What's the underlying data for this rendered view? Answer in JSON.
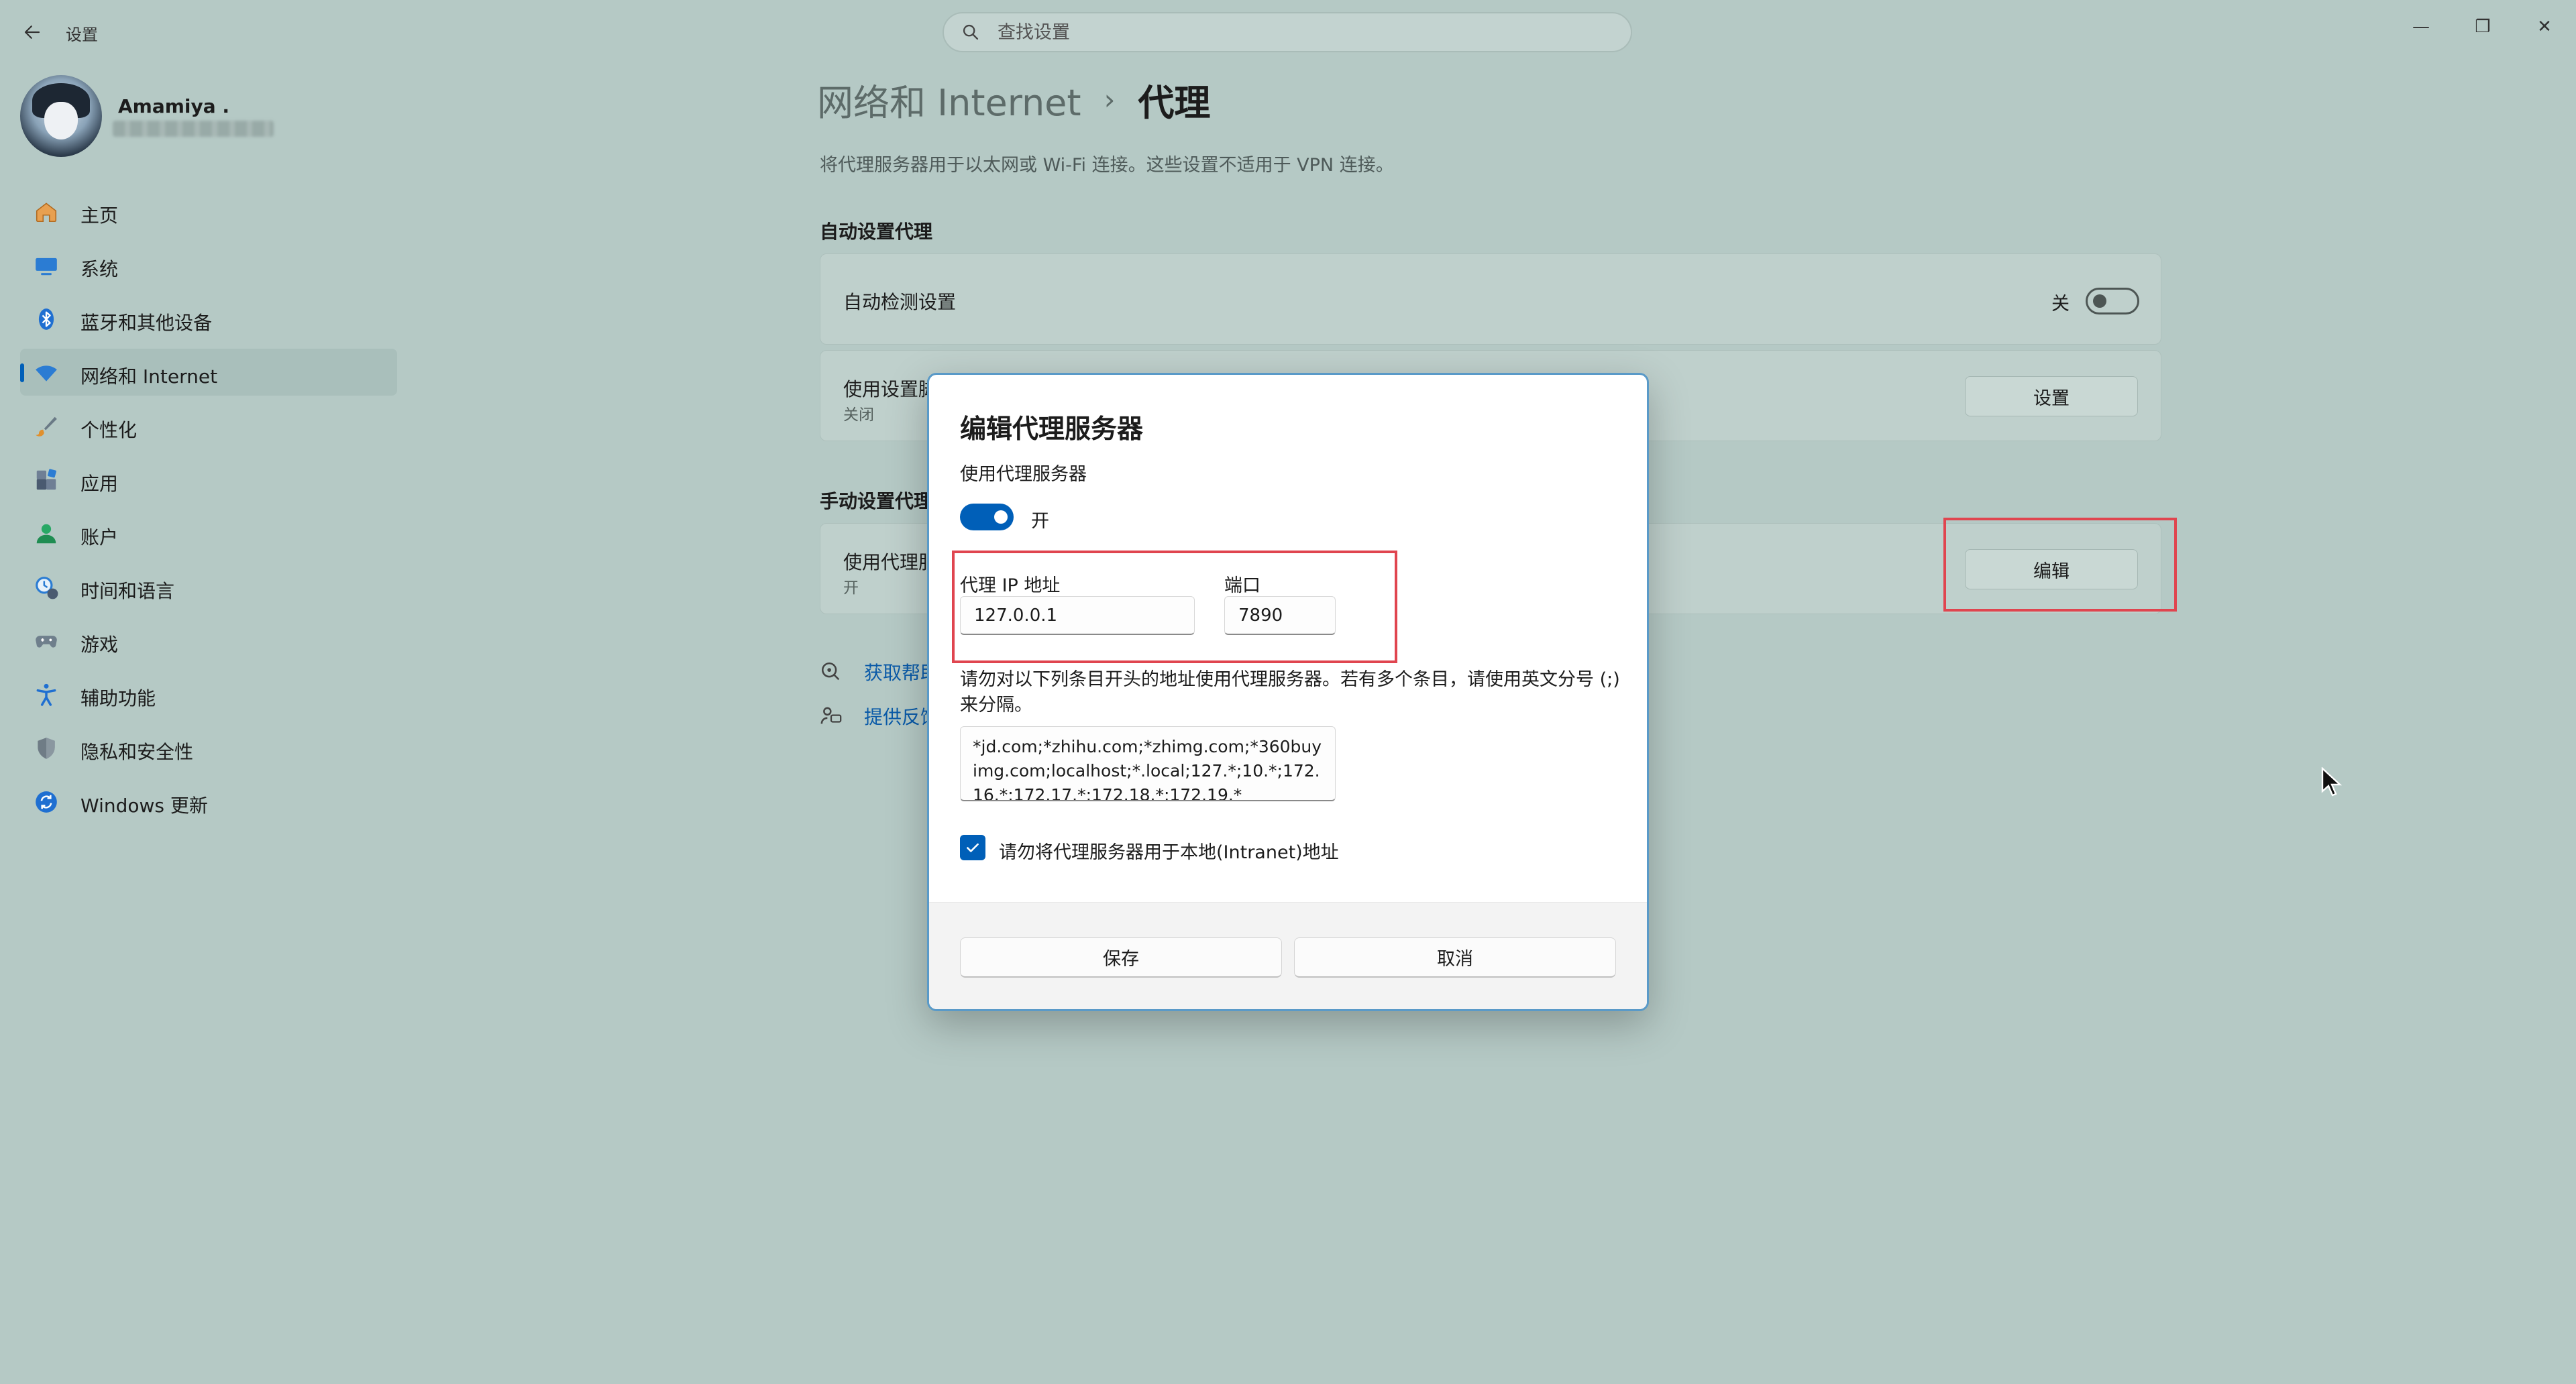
{
  "app": {
    "title": "设置",
    "window_controls": {
      "minimize": "—",
      "maximize": "❐",
      "close": "✕"
    }
  },
  "search": {
    "placeholder": "查找设置",
    "icon": "search-icon"
  },
  "profile": {
    "name": "Amamiya ."
  },
  "sidebar": {
    "items": [
      {
        "label": "主页",
        "icon": "home-icon"
      },
      {
        "label": "系统",
        "icon": "system-icon"
      },
      {
        "label": "蓝牙和其他设备",
        "icon": "bluetooth-icon"
      },
      {
        "label": "网络和 Internet",
        "icon": "wifi-icon",
        "active": true
      },
      {
        "label": "个性化",
        "icon": "brush-icon"
      },
      {
        "label": "应用",
        "icon": "apps-icon"
      },
      {
        "label": "账户",
        "icon": "account-icon"
      },
      {
        "label": "时间和语言",
        "icon": "time-language-icon"
      },
      {
        "label": "游戏",
        "icon": "gamepad-icon"
      },
      {
        "label": "辅助功能",
        "icon": "accessibility-icon"
      },
      {
        "label": "隐私和安全性",
        "icon": "shield-icon"
      },
      {
        "label": "Windows 更新",
        "icon": "update-icon"
      }
    ]
  },
  "main": {
    "breadcrumb": {
      "parent": "网络和 Internet",
      "separator": "›",
      "current": "代理"
    },
    "description": "将代理服务器用于以太网或 Wi-Fi 连接。这些设置不适用于 VPN 连接。",
    "auto_section": {
      "title": "自动设置代理",
      "auto_detect": {
        "label": "自动检测设置",
        "state_label": "关"
      },
      "setup_script": {
        "label": "使用设置脚本",
        "sub": "关闭",
        "button": "设置"
      }
    },
    "manual_section": {
      "title": "手动设置代理",
      "proxy_server": {
        "label": "使用代理服务器",
        "sub": "开",
        "button": "编辑"
      }
    },
    "help": {
      "get_help": "获取帮助",
      "feedback": "提供反馈"
    }
  },
  "dialog": {
    "title": "编辑代理服务器",
    "use_proxy_label": "使用代理服务器",
    "toggle_state": "开",
    "ip_label": "代理 IP 地址",
    "ip_value": "127.0.0.1",
    "port_label": "端口",
    "port_value": "7890",
    "exceptions_note": "请勿对以下列条目开头的地址使用代理服务器。若有多个条目，请使用英文分号 (;) 来分隔。",
    "exceptions_value": "*jd.com;*zhihu.com;*zhimg.com;*360buyimg.com;localhost;*.local;127.*;10.*;172.16.*;172.17.*;172.18.*;172.19.*",
    "bypass_local_label": "请勿将代理服务器用于本地(Intranet)地址",
    "bypass_local_checked": true,
    "save_label": "保存",
    "cancel_label": "取消"
  },
  "colors": {
    "accent": "#005fb8",
    "highlight": "#e0454f",
    "background": "#b5c9c5",
    "link": "#0a5aa8"
  }
}
